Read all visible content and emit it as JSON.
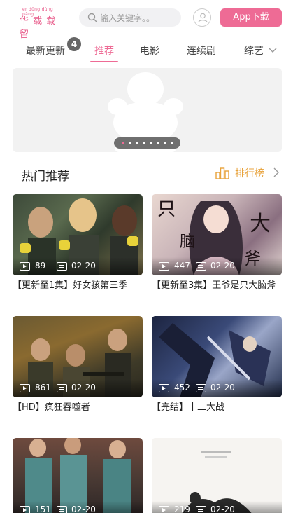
{
  "header": {
    "logo_pinyin": "er  dūng dùng pàng",
    "logo_text": "华 载 载 留",
    "search_placeholder": "输入关键字。。",
    "app_button": "App下载"
  },
  "tabs": {
    "items": [
      "最新更新",
      "推荐",
      "电影",
      "连续剧",
      "综艺"
    ],
    "active_index": 1,
    "badge_count": "4"
  },
  "banner": {
    "slide_count": 8,
    "active_slide": 0
  },
  "section": {
    "title": "热门推荐",
    "rank_label": "排行榜"
  },
  "cards": [
    {
      "views": "89",
      "date": "02-20",
      "title": "【更新至1集】好女孩第三季"
    },
    {
      "views": "447",
      "date": "02-20",
      "title": "【更新至3集】王爷是只大脑斧"
    },
    {
      "views": "861",
      "date": "02-20",
      "title": "【HD】疯狂吞噬者"
    },
    {
      "views": "452",
      "date": "02-20",
      "title": "【完结】十二大战"
    },
    {
      "views": "151",
      "date": "02-20",
      "title": ""
    },
    {
      "views": "219",
      "date": "02-20",
      "title": ""
    }
  ],
  "colors": {
    "accent": "#ee6b95",
    "rank": "#e8a23a"
  }
}
